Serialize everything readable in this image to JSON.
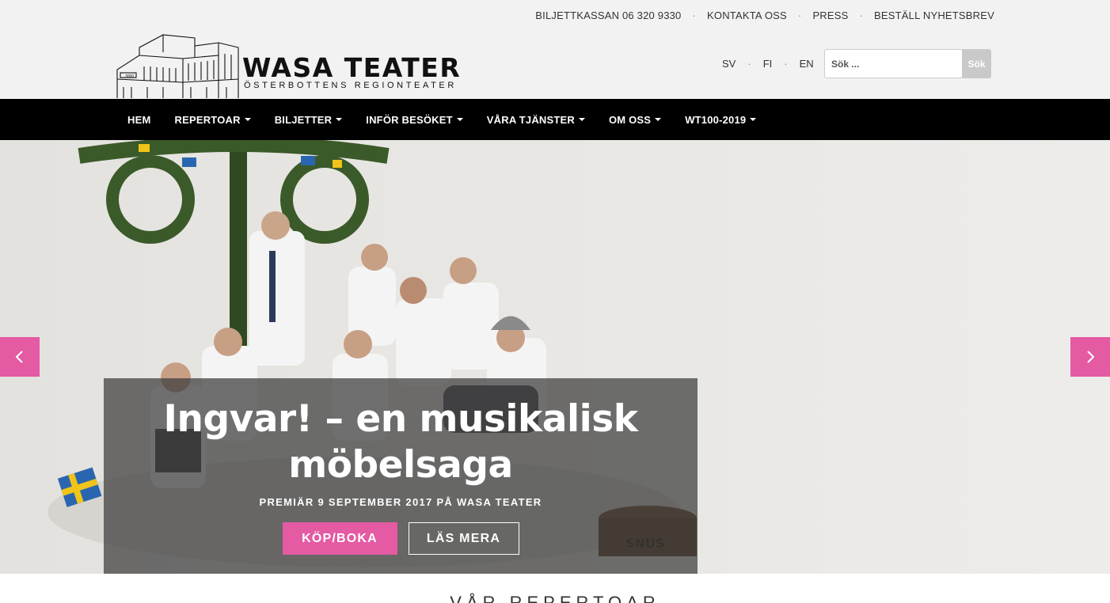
{
  "header": {
    "top_links": [
      "BILJETTKASSAN 06 320 9330",
      "KONTAKTA OSS",
      "PRESS",
      "BESTÄLL NYHETSBREV"
    ],
    "logo_title": "WASA TEATER",
    "logo_subtitle": "ÖSTERBOTTENS REGIONTEATER",
    "languages": [
      "SV",
      "FI",
      "EN"
    ],
    "search": {
      "placeholder": "Sök ...",
      "button_label": "Sök"
    }
  },
  "nav": {
    "items": [
      {
        "label": "HEM",
        "has_dropdown": false
      },
      {
        "label": "REPERTOAR",
        "has_dropdown": true
      },
      {
        "label": "BILJETTER",
        "has_dropdown": true
      },
      {
        "label": "INFÖR BESÖKET",
        "has_dropdown": true
      },
      {
        "label": "VÅRA TJÄNSTER",
        "has_dropdown": true
      },
      {
        "label": "OM OSS",
        "has_dropdown": true
      },
      {
        "label": "WT100-2019",
        "has_dropdown": true
      }
    ]
  },
  "hero": {
    "title": "Ingvar! – en musikalisk möbelsaga",
    "subtitle": "PREMIÄR 9 SEPTEMBER 2017 PÅ WASA TEATER",
    "primary_button": "KÖP/BOKA",
    "secondary_button": "LÄS MERA",
    "accent_color": "#e45aa3"
  },
  "section": {
    "title": "VÅR REPERTOAR"
  }
}
